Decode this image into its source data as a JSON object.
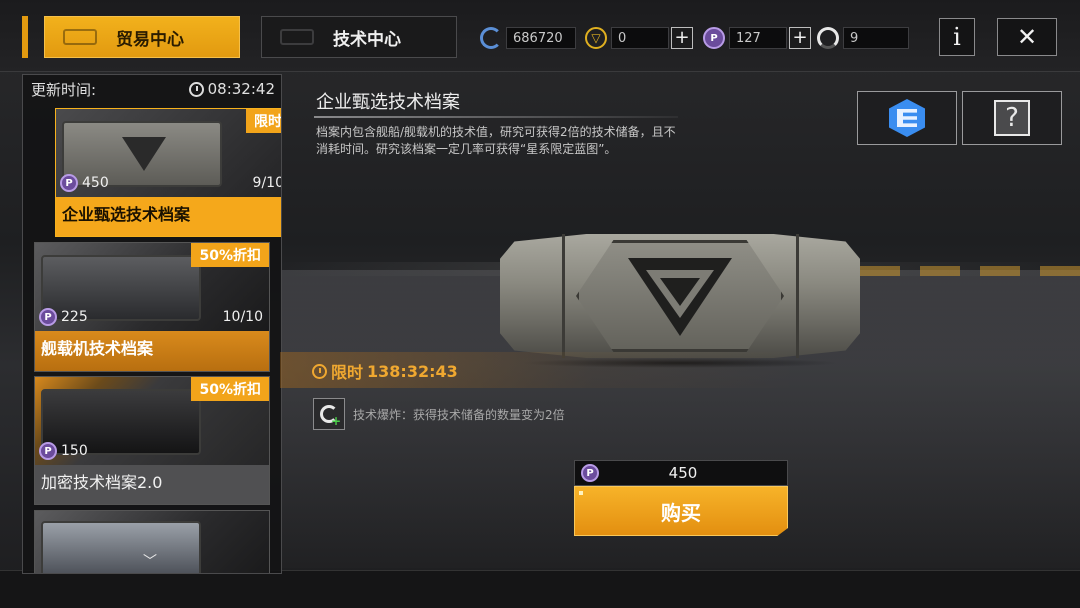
{
  "tabs": [
    {
      "label": "贸易中心",
      "active": true
    },
    {
      "label": "技术中心",
      "active": false
    }
  ],
  "currencies": [
    {
      "icon": "g-currency-icon",
      "value": "686720",
      "has_plus": false
    },
    {
      "icon": "triangle-coin-icon",
      "value": "0",
      "has_plus": true
    },
    {
      "icon": "p-coin-icon",
      "value": "127",
      "has_plus": true
    },
    {
      "icon": "half-circle-icon",
      "value": "9",
      "has_plus": false
    }
  ],
  "header_buttons": {
    "info": "i",
    "close": "✕"
  },
  "sidebar": {
    "refresh_label": "更新时间:",
    "refresh_timer": "08:32:42",
    "items": [
      {
        "title": "企业甄选技术档案",
        "price": "450",
        "stock": "9/10",
        "tag": "限时",
        "selected": true
      },
      {
        "title": "舰载机技术档案",
        "price": "225",
        "stock": "10/10",
        "tag": "50%折扣",
        "selected": false
      },
      {
        "title": "加密技术档案2.0",
        "price": "150",
        "stock": "",
        "tag": "50%折扣",
        "selected": false
      },
      {
        "title": "",
        "price": "",
        "stock": "",
        "tag": "",
        "selected": false
      }
    ]
  },
  "detail": {
    "title": "企业甄选技术档案",
    "description": "档案内包含舰船/舰载机的技术值，研究可获得2倍的技术储备，且不消耗时间。研究该档案一定几率可获得“星系限定蓝图”。",
    "limit_label": "限时",
    "limit_timer": "138:32:43",
    "buff_text": "技术爆炸：获得技术储备的数量变为2倍",
    "price": "450",
    "buy_label": "购买"
  },
  "colors": {
    "accent": "#f5a81b",
    "purple_coin": "#6b4c9c",
    "blue_icon": "#3a8df0"
  }
}
